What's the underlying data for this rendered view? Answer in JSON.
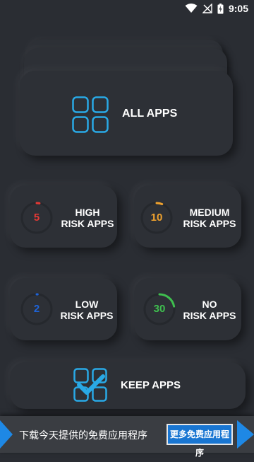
{
  "status_bar": {
    "time": "9:05"
  },
  "all_apps": {
    "label": "ALL APPS"
  },
  "risk_cards": {
    "high": {
      "count": "5",
      "line1": "HIGH",
      "line2": "RISK APPS",
      "color": "#e53935",
      "fraction": 0.03
    },
    "medium": {
      "count": "10",
      "line1": "MEDIUM",
      "line2": "RISK APPS",
      "color": "#f0a22e",
      "fraction": 0.06
    },
    "low": {
      "count": "2",
      "line1": "LOW",
      "line2": "RISK APPS",
      "color": "#1e63d8",
      "fraction": 0.01
    },
    "no": {
      "count": "30",
      "line1": "NO",
      "line2": "RISK APPS",
      "color": "#3fbf4f",
      "fraction": 0.22
    }
  },
  "keep_apps": {
    "label": "KEEP APPS"
  },
  "ad_banner": {
    "text": "下载今天提供的免费应用程序",
    "button": "更多免费应用程序"
  },
  "icons": {
    "wifi": "wifi-icon",
    "signal": "no-signal-icon",
    "battery": "battery-charging-icon",
    "grid": "app-grid-icon",
    "keep": "app-grid-check-icon"
  },
  "colors": {
    "accent_blue": "#29a9e6",
    "background": "#2a2d33"
  }
}
